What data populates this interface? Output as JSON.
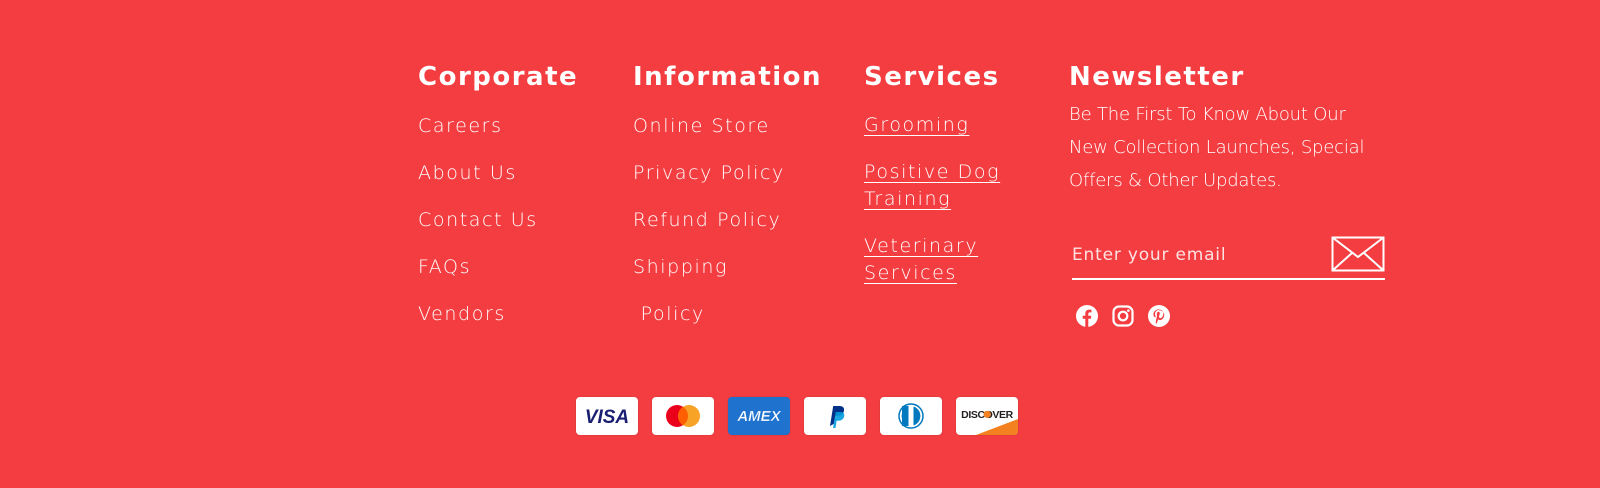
{
  "columns": {
    "corporate": {
      "title": "Corporate",
      "items": [
        "Careers",
        "About Us",
        "Contact Us",
        "FAQs",
        "Vendors"
      ]
    },
    "information": {
      "title": "Information",
      "items": [
        "Online Store",
        "Privacy Policy",
        "Refund Policy",
        "Shipping",
        " Policy"
      ]
    },
    "services": {
      "title": "Services",
      "items": [
        "Grooming ",
        "Positive Dog Training ",
        "Veterinary Services"
      ]
    },
    "newsletter": {
      "title": "Newsletter",
      "text": "Be The First To Know About Our New Collection Launches, Special Offers & Other Updates.",
      "email_placeholder": "Enter your email",
      "email_value": ""
    }
  },
  "social": [
    {
      "name": "Facebook",
      "icon": "facebook-icon"
    },
    {
      "name": "Instagram",
      "icon": "instagram-icon"
    },
    {
      "name": "Pinterest",
      "icon": "pinterest-icon"
    }
  ],
  "payments": {
    "visa": "VISA",
    "amex": "AMEX",
    "discover": "DISCOVER"
  },
  "colors": {
    "background": "#f43d41",
    "text": "#ffffff",
    "visa_blue": "#1a1f71",
    "amex_blue": "#1f72cd",
    "mastercard_red": "#eb001b",
    "mastercard_orange": "#f79e1b",
    "paypal_dark": "#003087",
    "paypal_light": "#009cde",
    "diners_blue": "#0079be",
    "discover_orange": "#f48120"
  }
}
